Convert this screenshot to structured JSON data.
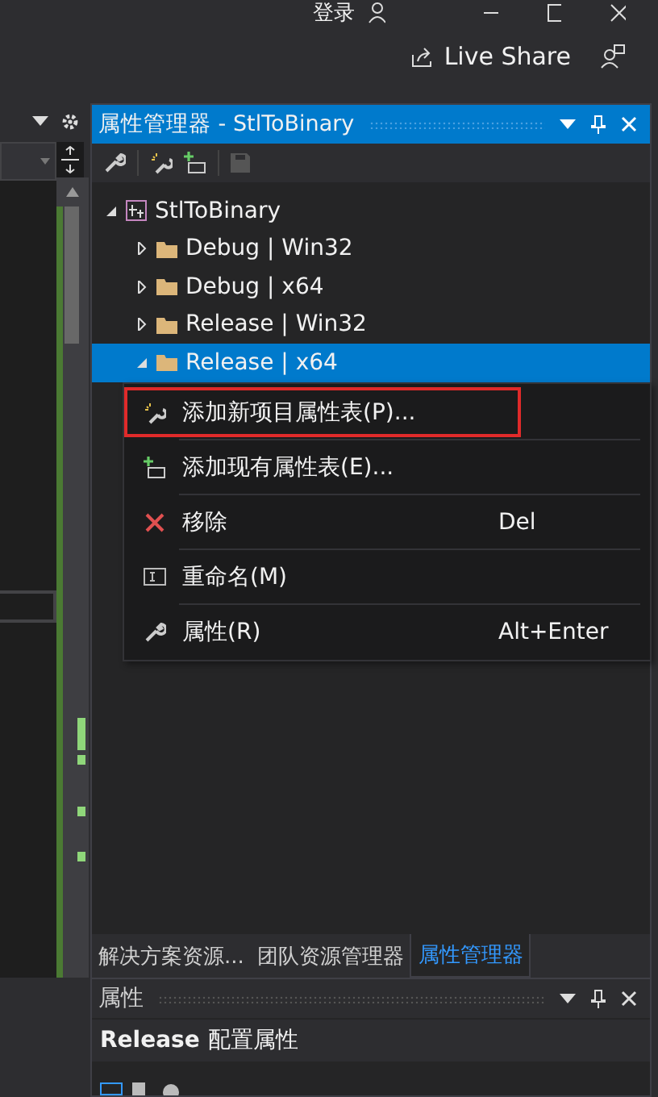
{
  "title_bar": {
    "sign_in": "登录"
  },
  "live_share": {
    "label": "Live Share"
  },
  "property_manager": {
    "title": "属性管理器 - StlToBinary",
    "tree": [
      {
        "label": "StlToBinary",
        "kind": "project",
        "expanded": true,
        "selected": false,
        "children": [
          {
            "label": "Debug | Win32",
            "kind": "folder",
            "expanded": false,
            "selected": false
          },
          {
            "label": "Debug | x64",
            "kind": "folder",
            "expanded": false,
            "selected": false
          },
          {
            "label": "Release | Win32",
            "kind": "folder",
            "expanded": false,
            "selected": false
          },
          {
            "label": "Release | x64",
            "kind": "folder",
            "expanded": true,
            "selected": true
          }
        ]
      }
    ]
  },
  "context_menu": {
    "items": [
      {
        "label": "添加新项目属性表(P)...",
        "kind": "add-new",
        "highlighted": true
      },
      {
        "label": "添加现有属性表(E)...",
        "kind": "add-existing",
        "highlighted": false
      },
      {
        "label": "移除",
        "kind": "remove",
        "highlighted": false,
        "shortcut": "Del"
      },
      {
        "label": "重命名(M)",
        "kind": "rename",
        "highlighted": false
      },
      {
        "label": "属性(R)",
        "kind": "properties",
        "highlighted": false,
        "shortcut": "Alt+Enter"
      }
    ]
  },
  "bottom_tabs": [
    {
      "label": "解决方案资源...",
      "selected": false
    },
    {
      "label": "团队资源管理器",
      "selected": false
    },
    {
      "label": "属性管理器",
      "selected": true
    }
  ],
  "properties_panel": {
    "title": "属性",
    "config": "Release",
    "config_label": "配置属性"
  }
}
